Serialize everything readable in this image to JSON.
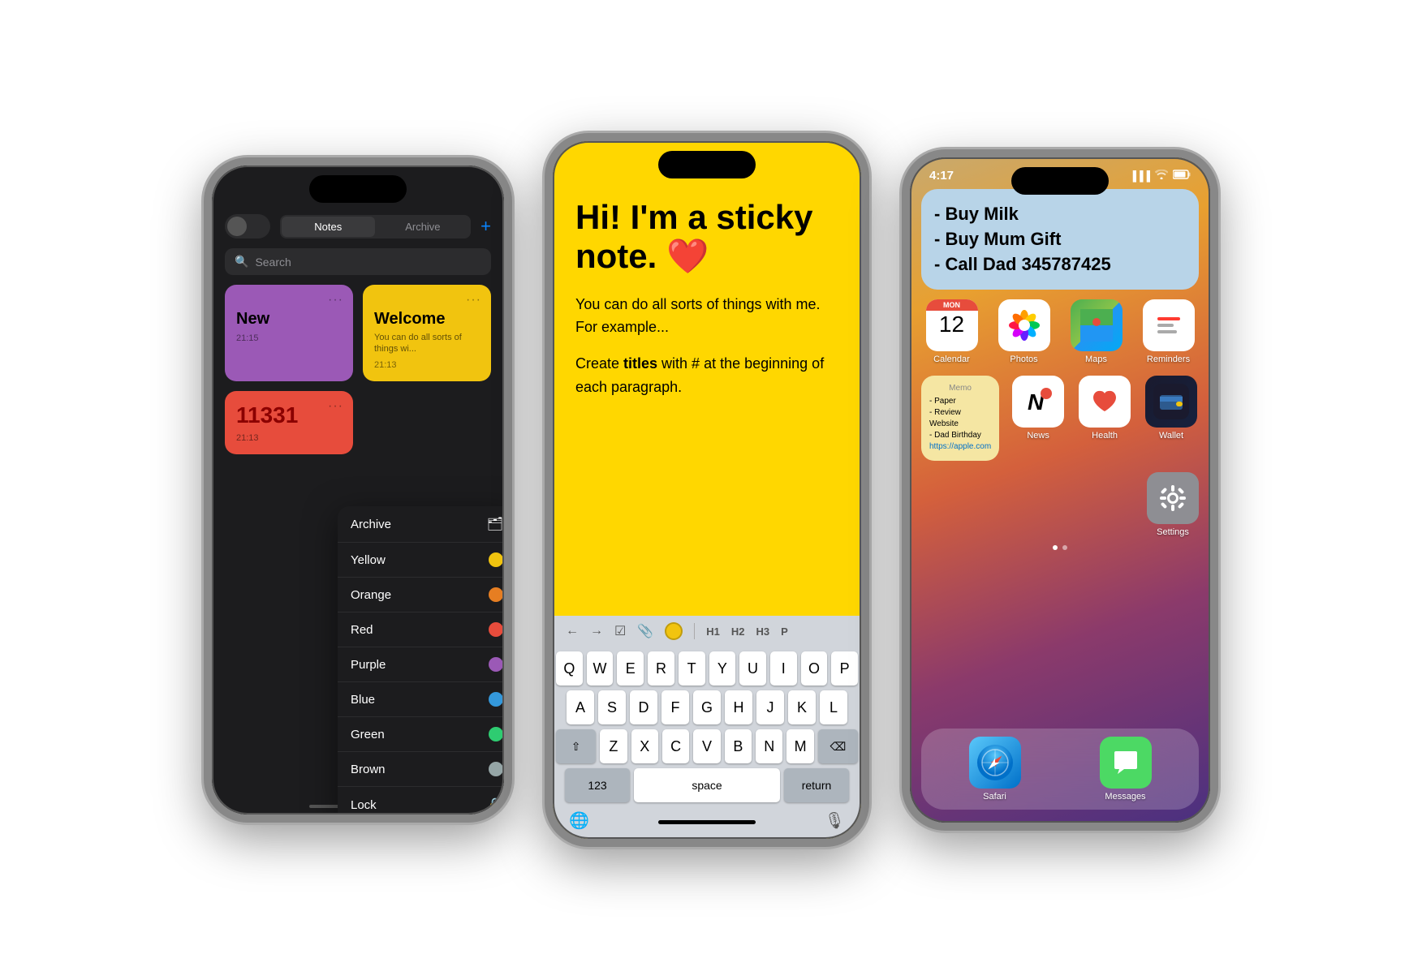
{
  "phone1": {
    "header": {
      "tab_notes": "Notes",
      "tab_archive": "Archive",
      "add_btn": "+"
    },
    "search_placeholder": "Search",
    "notes": [
      {
        "id": "new",
        "color": "purple",
        "title": "New",
        "body": "",
        "time": "21:15"
      },
      {
        "id": "welcome",
        "color": "yellow",
        "title": "Welcome",
        "body": "You can do all sorts of things wi...",
        "time": "21:13"
      },
      {
        "id": "red",
        "color": "red",
        "title": "11331",
        "body": "",
        "time": "21:13"
      }
    ],
    "context_menu": {
      "items": [
        {
          "label": "Archive",
          "icon": "archive"
        },
        {
          "label": "Yellow",
          "color": "#f1c40f"
        },
        {
          "label": "Orange",
          "color": "#e67e22"
        },
        {
          "label": "Red",
          "color": "#e74c3c"
        },
        {
          "label": "Purple",
          "color": "#9b59b6"
        },
        {
          "label": "Blue",
          "color": "#3498db"
        },
        {
          "label": "Green",
          "color": "#2ecc71"
        },
        {
          "label": "Brown",
          "color": "#95a5a6"
        },
        {
          "label": "Lock",
          "icon": "lock"
        }
      ]
    }
  },
  "phone2": {
    "note": {
      "title": "Hi! I'm a sticky note. ❤️",
      "paragraph1": "You can do all sorts of things with me. For example...",
      "paragraph2_prefix": "Create ",
      "paragraph2_bold": "titles",
      "paragraph2_suffix": " with # at the beginning of each paragraph."
    },
    "toolbar": {
      "undo": "←",
      "redo": "→",
      "checklist": "☑",
      "attachment": "📎",
      "h1": "H1",
      "h2": "H2",
      "h3": "H3",
      "p": "P"
    },
    "keyboard": {
      "row1": [
        "Q",
        "W",
        "E",
        "R",
        "T",
        "Y",
        "U",
        "I",
        "O",
        "P"
      ],
      "row2": [
        "A",
        "S",
        "D",
        "F",
        "G",
        "H",
        "J",
        "K",
        "L"
      ],
      "row3": [
        "Z",
        "X",
        "C",
        "V",
        "B",
        "N",
        "M"
      ],
      "space_label": "space",
      "return_label": "return",
      "num_label": "123"
    }
  },
  "phone3": {
    "status_bar": {
      "time": "4:17",
      "signal": "●●●",
      "wifi": "wifi",
      "battery": "battery"
    },
    "memo_widget": {
      "text": "- Buy Milk\n- Buy Mum Gift\n- Call Dad 345787425"
    },
    "apps_row1": [
      {
        "label": "Calendar",
        "type": "calendar",
        "day_abbr": "MON",
        "day_num": "12"
      },
      {
        "label": "Photos",
        "type": "photos"
      },
      {
        "label": "Maps",
        "type": "maps"
      },
      {
        "label": "Reminders",
        "type": "reminders"
      }
    ],
    "memo_small": {
      "label": "Memo",
      "text": "- Paper\n- Review Website\n- Dad Birthday\nhttps://apple.com"
    },
    "apps_row2": [
      {
        "label": "News",
        "type": "news"
      },
      {
        "label": "Health",
        "type": "health"
      },
      {
        "label": "Wallet",
        "type": "wallet"
      },
      {
        "label": "Settings",
        "type": "settings"
      }
    ],
    "dock": [
      {
        "label": "Safari",
        "type": "safari"
      },
      {
        "label": "Messages",
        "type": "messages"
      }
    ]
  }
}
